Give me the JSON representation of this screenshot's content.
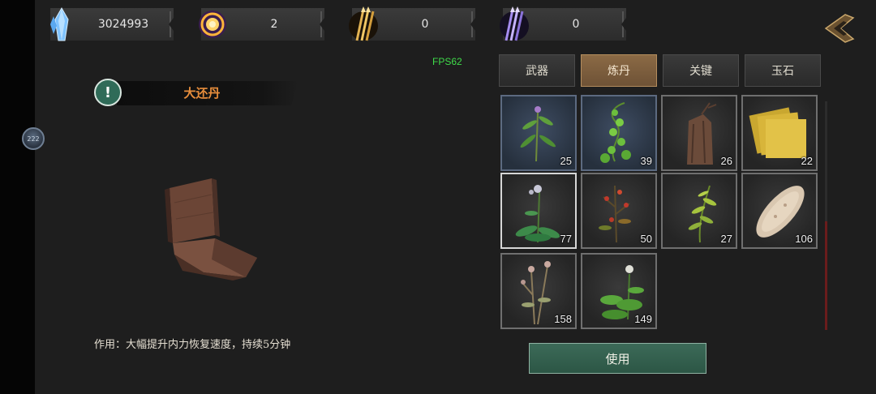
{
  "side_badge": "222",
  "currencies": [
    {
      "name": "blue-crystal-icon",
      "value": "3024993"
    },
    {
      "name": "gold-orb-icon",
      "value": "2"
    },
    {
      "name": "gold-arrows-icon",
      "value": "0"
    },
    {
      "name": "purple-arrows-icon",
      "value": "0"
    }
  ],
  "fps": "FPS62",
  "item": {
    "name": "大还丹",
    "description": "作用：大幅提升内力恢复速度，持续5分钟"
  },
  "tabs": [
    "武器",
    "炼丹",
    "关键",
    "玉石"
  ],
  "active_tab": 1,
  "slots": [
    {
      "icon": "herb-plant-icon",
      "count": "25"
    },
    {
      "icon": "vine-plant-icon",
      "count": "39"
    },
    {
      "icon": "tree-bark-icon",
      "count": "26"
    },
    {
      "icon": "yellow-paper-icon",
      "count": "22"
    },
    {
      "icon": "flower-herb-icon",
      "count": "77"
    },
    {
      "icon": "red-berry-plant-icon",
      "count": "50"
    },
    {
      "icon": "fern-plant-icon",
      "count": "27"
    },
    {
      "icon": "root-slice-icon",
      "count": "106"
    },
    {
      "icon": "dry-herb-icon",
      "count": "158"
    },
    {
      "icon": "leafy-herb-icon",
      "count": "149"
    }
  ],
  "use_button": "使用",
  "colors": {
    "active_tab": "#7d5e3e",
    "use_button": "#2f5c4b",
    "item_name": "#e88e3c",
    "fps": "#3fdc4a"
  }
}
